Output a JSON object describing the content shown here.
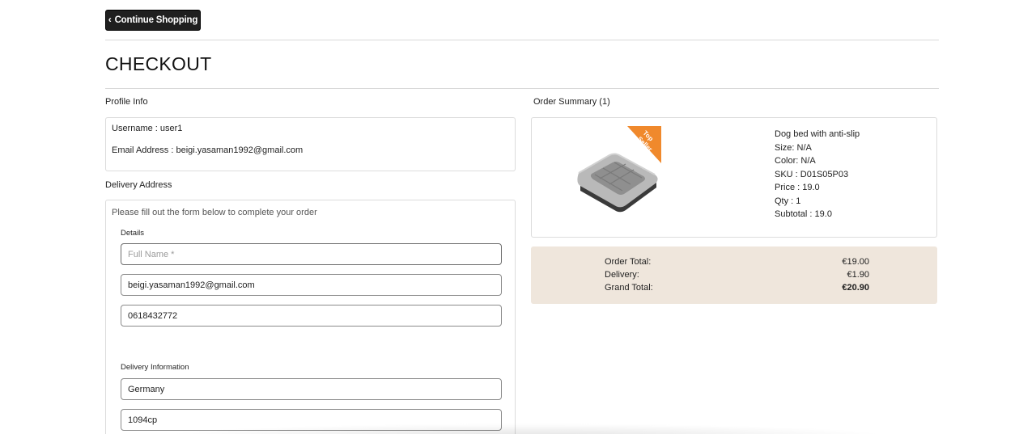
{
  "nav": {
    "continue_label": "Continue Shopping"
  },
  "page": {
    "title": "CHECKOUT"
  },
  "profile": {
    "section_label": "Profile Info",
    "username": "Username : user1",
    "email": "Email Address : beigi.yasaman1992@gmail.com"
  },
  "delivery": {
    "section_label": "Delivery Address",
    "intro": "Please fill out the form below to complete your order",
    "details_label": "Details",
    "full_name_placeholder": "Full Name *",
    "email_value": "beigi.yasaman1992@gmail.com",
    "phone_value": "0618432772",
    "delivery_info_label": "Delivery Information",
    "country_value": "Germany",
    "postcode_value": "1094cp"
  },
  "summary": {
    "section_label": "Order Summary (1)",
    "product": {
      "badge": "Top Seller",
      "name": "Dog bed with anti-slip",
      "size": "Size: N/A",
      "color": "Color: N/A",
      "sku": "SKU : D01S05P03",
      "price": "Price : 19.0",
      "qty": "Qty : 1",
      "subtotal": "Subtotal : 19.0"
    },
    "totals": {
      "order_total_label": "Order Total:",
      "order_total_value": "€19.00",
      "delivery_label": "Delivery:",
      "delivery_value": "€1.90",
      "grand_total_label": "Grand Total:",
      "grand_total_value": "€20.90"
    }
  },
  "colors": {
    "button_bg": "#1f1f1f",
    "badge": "#f0892c",
    "totals_bg": "#efe6dc"
  }
}
